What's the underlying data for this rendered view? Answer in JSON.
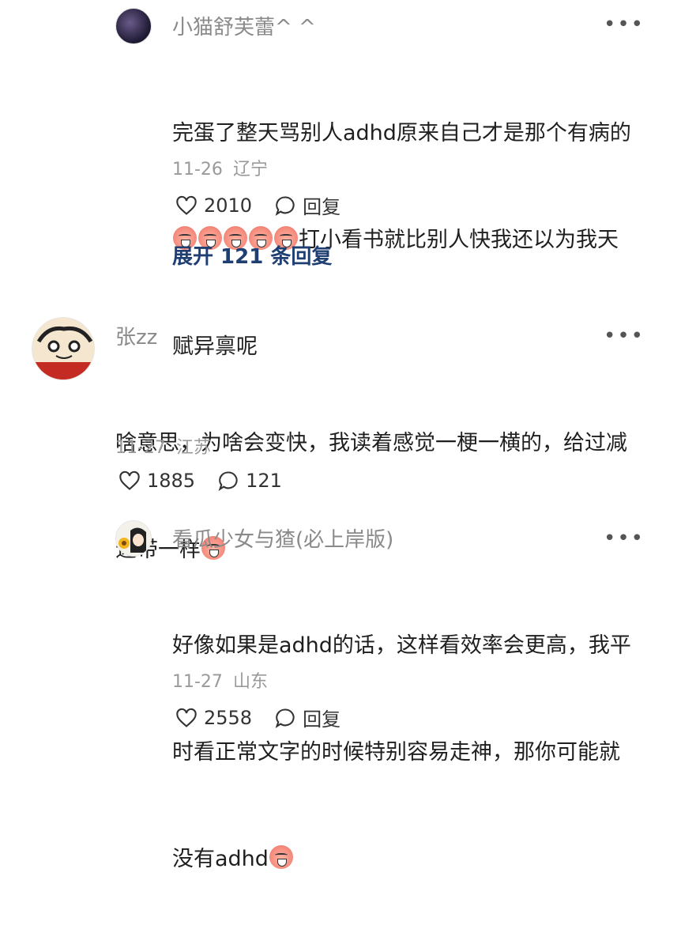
{
  "comments": [
    {
      "username": "小猫舒芙蕾^ ^",
      "text_line1": "完蛋了整天骂别人adhd原来自己才是那个有病的",
      "text_line2_suffix": "打小看书就比别人快我还以为我天",
      "text_line3": "赋异禀呢",
      "date": "11-26",
      "location": "辽宁",
      "likes": "2010",
      "reply_label": "回复",
      "expand_label": "展开 121 条回复"
    },
    {
      "username": "张zz",
      "text_line1": "啥意思，为啥会变快，我读着感觉一梗一横的，给过减",
      "text_line2_prefix": "速带一样",
      "date": "11-27",
      "location": "江苏",
      "likes": "1885",
      "replies": "121"
    },
    {
      "username": "看瓜少女与猹(必上岸版)",
      "text_line1": "好像如果是adhd的话，这样看效率会更高，我平",
      "text_line2": "时看正常文字的时候特别容易走神，那你可能就",
      "text_line3_prefix": "没有adhd",
      "date": "11-27",
      "location": "山东",
      "likes": "2558",
      "reply_label": "回复"
    }
  ],
  "more_icon": "more-dots-icon",
  "emoji_icon": "crying-face-emoji"
}
